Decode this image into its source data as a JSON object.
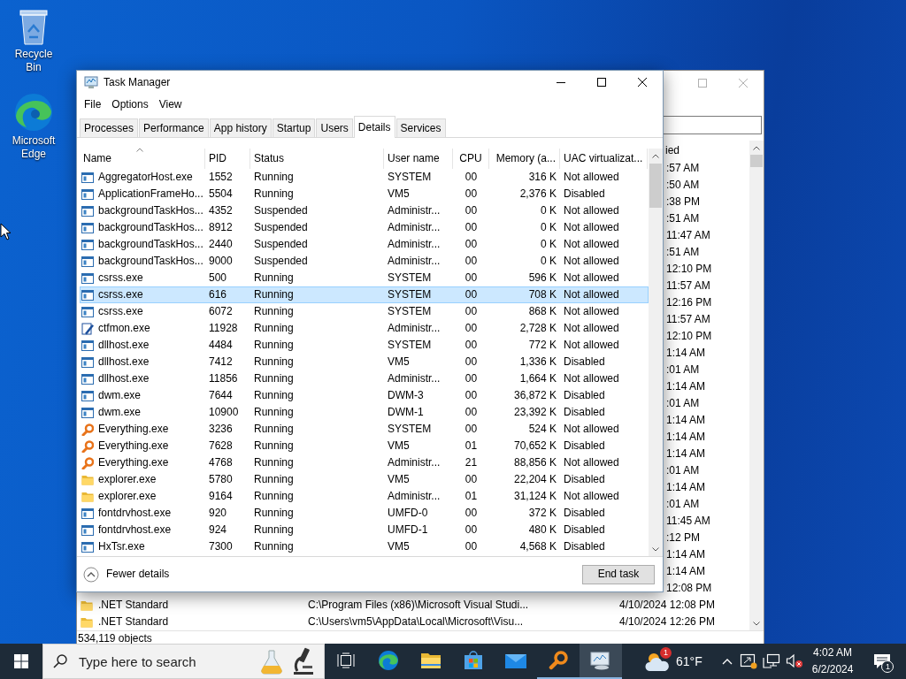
{
  "desktop_icons": [
    {
      "kind": "bin",
      "label": "Recycle Bin"
    },
    {
      "kind": "browser",
      "label": "Microsoft Edge"
    }
  ],
  "back_window": {
    "column_header": "ied",
    "rows": [
      {
        "date": ":57 AM"
      },
      {
        "date": ":50 AM"
      },
      {
        "date": ":38 PM"
      },
      {
        "date": ":51 AM"
      },
      {
        "date": "11:47 AM"
      },
      {
        "date": ":51 AM"
      },
      {
        "date": "12:10 PM"
      },
      {
        "date": "11:57 AM"
      },
      {
        "date": "12:16 PM"
      },
      {
        "date": "11:57 AM"
      },
      {
        "date": "12:10 PM"
      },
      {
        "date": "1:14 AM"
      },
      {
        "date": ":01 AM"
      },
      {
        "date": "1:14 AM"
      },
      {
        "date": ":01 AM"
      },
      {
        "date": "1:14 AM"
      },
      {
        "date": "1:14 AM"
      },
      {
        "date": "1:14 AM"
      },
      {
        "date": ":01 AM"
      },
      {
        "date": "1:14 AM"
      },
      {
        "date": ":01 AM"
      },
      {
        "date": "11:45 AM"
      },
      {
        "date": ":12 PM"
      },
      {
        "date": "1:14 AM"
      },
      {
        "date": "1:14 AM"
      },
      {
        "date": "12:08 PM"
      },
      {
        "name": ".NET Standard",
        "path": "C:\\Program Files (x86)\\Microsoft Visual Studi...",
        "date": "4/10/2024 12:08 PM"
      },
      {
        "name": ".NET Standard",
        "path": "C:\\Users\\vm5\\AppData\\Local\\Microsoft\\Visu...",
        "date": "4/10/2024 12:26 PM"
      }
    ],
    "status": "534,119 objects"
  },
  "task_manager": {
    "title": "Task Manager",
    "menu": [
      "File",
      "Options",
      "View"
    ],
    "tabs": [
      {
        "label": "Processes",
        "selected": false
      },
      {
        "label": "Performance",
        "selected": false
      },
      {
        "label": "App history",
        "selected": false
      },
      {
        "label": "Startup",
        "selected": false
      },
      {
        "label": "Users",
        "selected": false
      },
      {
        "label": "Details",
        "selected": true
      },
      {
        "label": "Services",
        "selected": false
      }
    ],
    "columns": [
      "Name",
      "PID",
      "Status",
      "User name",
      "CPU",
      "Memory (a...",
      "UAC virtualizat..."
    ],
    "rows": [
      {
        "kind": "app",
        "name": "AggregatorHost.exe",
        "pid": "1552",
        "status": "Running",
        "user": "SYSTEM",
        "cpu": "00",
        "memory": "316 K",
        "uac": "Not allowed",
        "selected": false
      },
      {
        "kind": "app",
        "name": "ApplicationFrameHo...",
        "pid": "5504",
        "status": "Running",
        "user": "VM5",
        "cpu": "00",
        "memory": "2,376 K",
        "uac": "Disabled",
        "selected": false
      },
      {
        "kind": "app",
        "name": "backgroundTaskHos...",
        "pid": "4352",
        "status": "Suspended",
        "user": "Administr...",
        "cpu": "00",
        "memory": "0 K",
        "uac": "Not allowed",
        "selected": false
      },
      {
        "kind": "app",
        "name": "backgroundTaskHos...",
        "pid": "8912",
        "status": "Suspended",
        "user": "Administr...",
        "cpu": "00",
        "memory": "0 K",
        "uac": "Not allowed",
        "selected": false
      },
      {
        "kind": "app",
        "name": "backgroundTaskHos...",
        "pid": "2440",
        "status": "Suspended",
        "user": "Administr...",
        "cpu": "00",
        "memory": "0 K",
        "uac": "Not allowed",
        "selected": false
      },
      {
        "kind": "app",
        "name": "backgroundTaskHos...",
        "pid": "9000",
        "status": "Suspended",
        "user": "Administr...",
        "cpu": "00",
        "memory": "0 K",
        "uac": "Not allowed",
        "selected": false
      },
      {
        "kind": "app",
        "name": "csrss.exe",
        "pid": "500",
        "status": "Running",
        "user": "SYSTEM",
        "cpu": "00",
        "memory": "596 K",
        "uac": "Not allowed",
        "selected": false
      },
      {
        "kind": "app",
        "name": "csrss.exe",
        "pid": "616",
        "status": "Running",
        "user": "SYSTEM",
        "cpu": "00",
        "memory": "708 K",
        "uac": "Not allowed",
        "selected": true
      },
      {
        "kind": "app",
        "name": "csrss.exe",
        "pid": "6072",
        "status": "Running",
        "user": "SYSTEM",
        "cpu": "00",
        "memory": "868 K",
        "uac": "Not allowed",
        "selected": false
      },
      {
        "kind": "pen",
        "name": "ctfmon.exe",
        "pid": "11928",
        "status": "Running",
        "user": "Administr...",
        "cpu": "00",
        "memory": "2,728 K",
        "uac": "Not allowed",
        "selected": false
      },
      {
        "kind": "app",
        "name": "dllhost.exe",
        "pid": "4484",
        "status": "Running",
        "user": "SYSTEM",
        "cpu": "00",
        "memory": "772 K",
        "uac": "Not allowed",
        "selected": false
      },
      {
        "kind": "app",
        "name": "dllhost.exe",
        "pid": "7412",
        "status": "Running",
        "user": "VM5",
        "cpu": "00",
        "memory": "1,336 K",
        "uac": "Disabled",
        "selected": false
      },
      {
        "kind": "app",
        "name": "dllhost.exe",
        "pid": "11856",
        "status": "Running",
        "user": "Administr...",
        "cpu": "00",
        "memory": "1,664 K",
        "uac": "Not allowed",
        "selected": false
      },
      {
        "kind": "app",
        "name": "dwm.exe",
        "pid": "7644",
        "status": "Running",
        "user": "DWM-3",
        "cpu": "00",
        "memory": "36,872 K",
        "uac": "Disabled",
        "selected": false
      },
      {
        "kind": "app",
        "name": "dwm.exe",
        "pid": "10900",
        "status": "Running",
        "user": "DWM-1",
        "cpu": "00",
        "memory": "23,392 K",
        "uac": "Disabled",
        "selected": false
      },
      {
        "kind": "search",
        "name": "Everything.exe",
        "pid": "3236",
        "status": "Running",
        "user": "SYSTEM",
        "cpu": "00",
        "memory": "524 K",
        "uac": "Not allowed",
        "selected": false
      },
      {
        "kind": "search",
        "name": "Everything.exe",
        "pid": "7628",
        "status": "Running",
        "user": "VM5",
        "cpu": "01",
        "memory": "70,652 K",
        "uac": "Disabled",
        "selected": false
      },
      {
        "kind": "search",
        "name": "Everything.exe",
        "pid": "4768",
        "status": "Running",
        "user": "Administr...",
        "cpu": "21",
        "memory": "88,856 K",
        "uac": "Not allowed",
        "selected": false
      },
      {
        "kind": "folder",
        "name": "explorer.exe",
        "pid": "5780",
        "status": "Running",
        "user": "VM5",
        "cpu": "00",
        "memory": "22,204 K",
        "uac": "Disabled",
        "selected": false
      },
      {
        "kind": "folder",
        "name": "explorer.exe",
        "pid": "9164",
        "status": "Running",
        "user": "Administr...",
        "cpu": "01",
        "memory": "31,124 K",
        "uac": "Not allowed",
        "selected": false
      },
      {
        "kind": "app",
        "name": "fontdrvhost.exe",
        "pid": "920",
        "status": "Running",
        "user": "UMFD-0",
        "cpu": "00",
        "memory": "372 K",
        "uac": "Disabled",
        "selected": false
      },
      {
        "kind": "app",
        "name": "fontdrvhost.exe",
        "pid": "924",
        "status": "Running",
        "user": "UMFD-1",
        "cpu": "00",
        "memory": "480 K",
        "uac": "Disabled",
        "selected": false
      },
      {
        "kind": "app",
        "name": "HxTsr.exe",
        "pid": "7300",
        "status": "Running",
        "user": "VM5",
        "cpu": "00",
        "memory": "4,568 K",
        "uac": "Disabled",
        "selected": false
      }
    ],
    "fewer_details": "Fewer details",
    "end_task": "End task"
  },
  "taskbar": {
    "search": {
      "placeholder": "Type here to search"
    },
    "apps": [
      {
        "kind": "taskview",
        "running": false,
        "active": false
      },
      {
        "kind": "browser",
        "running": false,
        "active": false
      },
      {
        "kind": "folder",
        "running": false,
        "active": false
      },
      {
        "kind": "store",
        "running": false,
        "active": false
      },
      {
        "kind": "mail",
        "running": false,
        "active": false
      },
      {
        "kind": "search",
        "running": true,
        "active": false
      },
      {
        "kind": "monitor",
        "running": true,
        "active": true
      }
    ],
    "weather": {
      "badge": "1",
      "temperature": "61°F"
    },
    "clock": {
      "time": "4:02 AM",
      "date": "6/2/2024"
    },
    "notifications": {
      "count": "1"
    }
  }
}
